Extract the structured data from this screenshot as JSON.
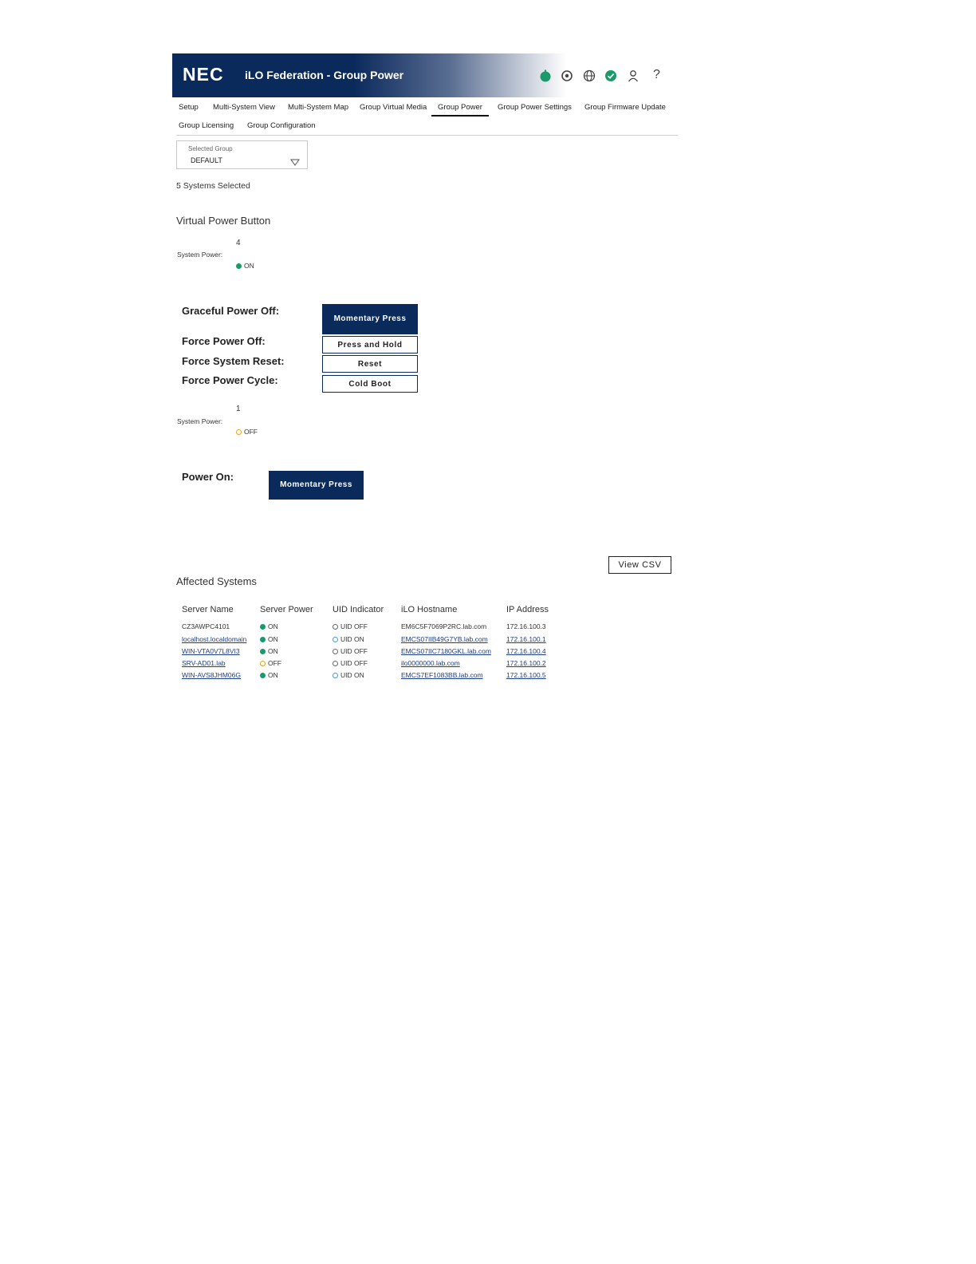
{
  "header": {
    "logo": "NEC",
    "title": "iLO Federation - Group Power",
    "icons": [
      "health-status-icon",
      "location-icon",
      "globe-icon",
      "check-status-icon",
      "user-icon",
      "help-icon"
    ],
    "help_glyph": "?"
  },
  "tabs": [
    {
      "label": "Setup"
    },
    {
      "label": "Multi-System View"
    },
    {
      "label": "Multi-System Map"
    },
    {
      "label": "Group Virtual Media"
    },
    {
      "label": "Group Power",
      "active": true
    },
    {
      "label": "Group Power Settings"
    },
    {
      "label": "Group Firmware Update"
    },
    {
      "label": "Group Licensing"
    },
    {
      "label": "Group Configuration"
    }
  ],
  "group_select": {
    "label": "Selected Group",
    "value": "DEFAULT"
  },
  "systems_selected": "5 Systems Selected",
  "virtual_power_button": {
    "title": "Virtual Power Button",
    "on_group": {
      "count": "4",
      "label": "System Power:",
      "status": "ON"
    },
    "actions": [
      {
        "label": "Graceful Power Off:",
        "button": "Momentary Press"
      },
      {
        "label": "Force Power Off:",
        "button": "Press and Hold"
      },
      {
        "label": "Force System Reset:",
        "button": "Reset"
      },
      {
        "label": "Force Power Cycle:",
        "button": "Cold Boot"
      }
    ],
    "off_group": {
      "count": "1",
      "label": "System Power:",
      "status": "OFF"
    },
    "power_on": {
      "label": "Power On:",
      "button": "Momentary Press"
    }
  },
  "affected": {
    "title": "Affected Systems",
    "view_csv": "View CSV",
    "columns": [
      "Server Name",
      "Server Power",
      "UID Indicator",
      "iLO Hostname",
      "IP Address"
    ],
    "rows": [
      {
        "name": "CZ3AWPC4101",
        "power": "ON",
        "uid": "UID OFF",
        "hostname": "EM6C5F7069P2RC.lab.com",
        "ip": "172.16.100.3"
      },
      {
        "name": "localhost.localdomain",
        "power": "ON",
        "uid": "UID ON",
        "hostname": "EMCS07IIB49G7YB.lab.com",
        "ip": "172.16.100.1"
      },
      {
        "name": "WIN-VTA0V7L8VI3",
        "power": "ON",
        "uid": "UID OFF",
        "hostname": "EMCS07IIC7180GKL.lab.com",
        "ip": "172.16.100.4"
      },
      {
        "name": "SRV-AD01.lab",
        "power": "OFF",
        "uid": "UID OFF",
        "hostname": "ilo0000000.lab.com",
        "ip": "172.16.100.2"
      },
      {
        "name": "WIN-AVS8JHM06G",
        "power": "ON",
        "uid": "UID ON",
        "hostname": "EMCS7EF1083BB.lab.com",
        "ip": "172.16.100.5"
      }
    ]
  },
  "colors": {
    "brand": "#0b2a5c",
    "on": "#1a9a6a",
    "off": "#e8a41c",
    "uid_on": "#3aa0d8"
  }
}
